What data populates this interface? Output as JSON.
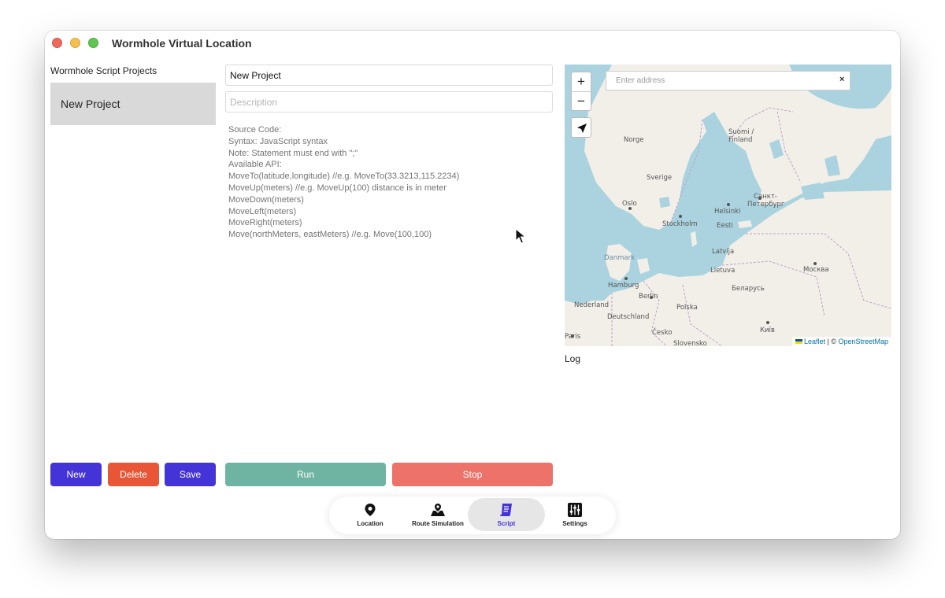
{
  "window": {
    "title": "Wormhole Virtual Location"
  },
  "sidebar": {
    "heading": "Wormhole Script Projects",
    "projects": [
      "New Project"
    ]
  },
  "editor": {
    "name_value": "New Project",
    "description_placeholder": "Description",
    "source_placeholder": "Source Code:\nSyntax: JavaScript syntax\nNote: Statement must end with \";\"\nAvailable API:\nMoveTo(latitude,longitude) //e.g. MoveTo(33.3213,115.2234)\nMoveUp(meters) //e.g. MoveUp(100) distance is in meter\nMoveDown(meters)\nMoveLeft(meters)\nMoveRight(meters)\nMove(northMeters, eastMeters) //e.g. Move(100,100)"
  },
  "map": {
    "zoom_in": "+",
    "zoom_out": "−",
    "address_placeholder": "Enter address",
    "clear": "×",
    "attribution_leaflet": "Leaflet",
    "attribution_sep": " | © ",
    "attribution_osm": "OpenStreetMap",
    "labels": [
      "Norge",
      "Suomi /",
      "Finland",
      "Sverige",
      "Oslo",
      "Санкт-",
      "Петербург",
      "Helsinki",
      "Stockholm",
      "Eesti",
      "Danmark",
      "Latvija",
      "Lietuva",
      "Москва",
      "Hamburg",
      "Berlin",
      "Беларусь",
      "Nederland",
      "Polska",
      "Deutschland",
      "Česko",
      "Київ",
      "Paris",
      "Slovensko"
    ]
  },
  "log": {
    "label": "Log"
  },
  "buttons": {
    "new": "New",
    "delete": "Delete",
    "save": "Save",
    "run": "Run",
    "stop": "Stop"
  },
  "tabs": {
    "location": "Location",
    "route": "Route Simulation",
    "script": "Script",
    "settings": "Settings"
  },
  "colors": {
    "accent": "#4433d6",
    "danger": "#e95637",
    "run": "#6fb4a2",
    "stop": "#ec726a",
    "sea": "#aad3df",
    "land": "#f2efe9"
  }
}
